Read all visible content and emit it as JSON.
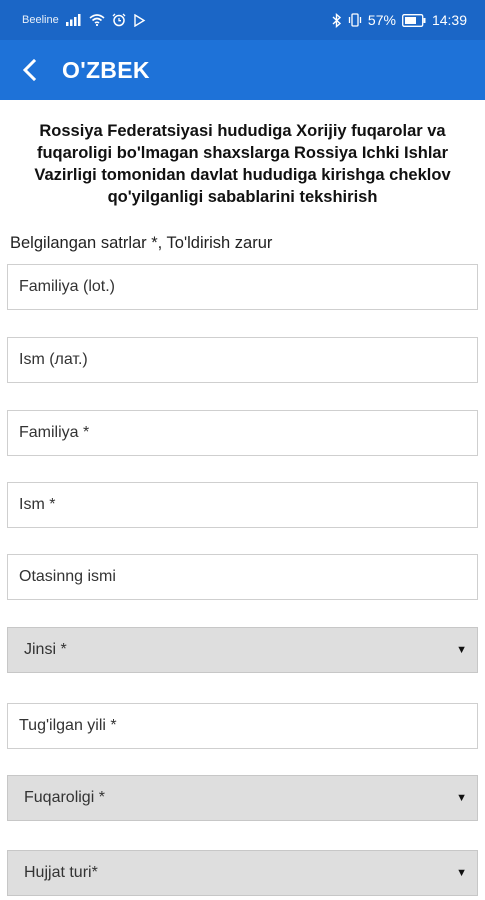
{
  "status_bar": {
    "carrier": "Beeline",
    "battery_percent": "57%",
    "time": "14:39"
  },
  "app_bar": {
    "title": "O'ZBEK"
  },
  "heading": "Rossiya Federatsiyasi hududiga Xorijiy fuqarolar va fuqaroligi bo'lmagan shaxslarga Rossiya Ichki Ishlar Vazirligi tomonidan davlat hududiga kirishga cheklov qo'yilganligi sabablarini tekshirish",
  "required_note": "Belgilangan satrlar *, To'ldirish zarur",
  "form": {
    "surname_lat": "Familiya (lot.)",
    "name_lat": "Ism (лат.)",
    "surname": "Familiya *",
    "name": "Ism *",
    "patronymic": "Otasinng ismi",
    "gender": "Jinsi *",
    "birth_year": "Tug'ilgan yili *",
    "citizenship": "Fuqaroligi *",
    "document_type": "Hujjat turi*"
  },
  "colors": {
    "status_bar": "#1b66c6",
    "app_bar": "#1e72d8",
    "select_bg": "#dedede"
  }
}
